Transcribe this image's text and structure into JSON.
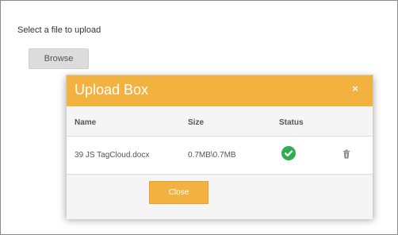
{
  "page": {
    "select_label": "Select a file to upload",
    "browse_label": "Browse"
  },
  "modal": {
    "title": "Upload Box",
    "close_glyph": "×",
    "columns": [
      "Name",
      "Size",
      "Status"
    ],
    "rows": [
      {
        "name": "39 JS TagCloud.docx",
        "size": "0.7MB\\0.7MB",
        "status_icon": "check-circle-icon",
        "action_icon": "trash-icon"
      }
    ],
    "close_label": "Close"
  },
  "colors": {
    "header_bg": "#f3b240",
    "status_success": "#2fae4f",
    "browse_bg": "#dcdcdc"
  }
}
